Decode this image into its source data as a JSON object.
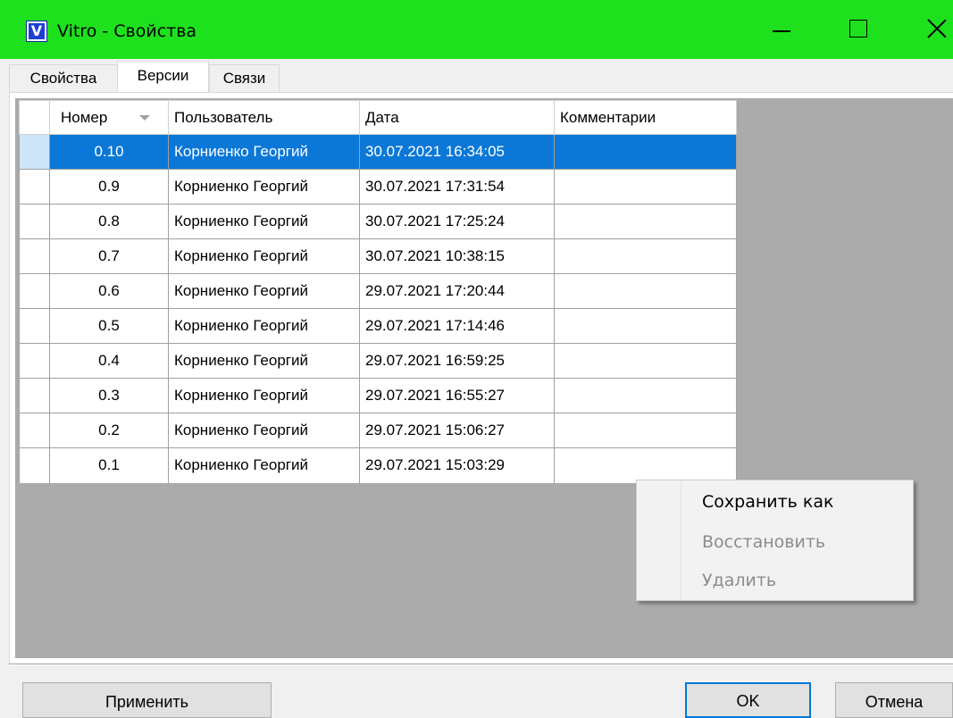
{
  "window": {
    "app_icon_letter": "V",
    "title": "Vitro - Свойства",
    "titlebar_color": "#1ee11e"
  },
  "tabs": [
    {
      "label": "Свойства",
      "active": false
    },
    {
      "label": "Версии",
      "active": true
    },
    {
      "label": "Связи",
      "active": false
    }
  ],
  "grid": {
    "columns": [
      "Номер",
      "Пользователь",
      "Дата",
      "Комментарии"
    ],
    "sort_column": "Номер",
    "selected_row": 0,
    "rows": [
      {
        "number": "0.10",
        "user": "Корниенко Георгий",
        "date": "30.07.2021 16:34:05",
        "comment": ""
      },
      {
        "number": "0.9",
        "user": "Корниенко Георгий",
        "date": "30.07.2021 17:31:54",
        "comment": ""
      },
      {
        "number": "0.8",
        "user": "Корниенко Георгий",
        "date": "30.07.2021 17:25:24",
        "comment": ""
      },
      {
        "number": "0.7",
        "user": "Корниенко Георгий",
        "date": "30.07.2021 10:38:15",
        "comment": ""
      },
      {
        "number": "0.6",
        "user": "Корниенко Георгий",
        "date": "29.07.2021 17:20:44",
        "comment": ""
      },
      {
        "number": "0.5",
        "user": "Корниенко Георгий",
        "date": "29.07.2021 17:14:46",
        "comment": ""
      },
      {
        "number": "0.4",
        "user": "Корниенко Георгий",
        "date": "29.07.2021 16:59:25",
        "comment": ""
      },
      {
        "number": "0.3",
        "user": "Корниенко Георгий",
        "date": "29.07.2021 16:55:27",
        "comment": ""
      },
      {
        "number": "0.2",
        "user": "Корниенко Георгий",
        "date": "29.07.2021 15:06:27",
        "comment": ""
      },
      {
        "number": "0.1",
        "user": "Корниенко Георгий",
        "date": "29.07.2021 15:03:29",
        "comment": ""
      }
    ]
  },
  "context_menu": {
    "items": [
      {
        "label": "Сохранить как",
        "enabled": true
      },
      {
        "label": "Восстановить",
        "enabled": false
      },
      {
        "label": "Удалить",
        "enabled": false
      }
    ]
  },
  "buttons": {
    "apply": "Применить",
    "ok": "OK",
    "cancel": "Отмена"
  },
  "colors": {
    "selection": "#0b78d7",
    "grid_background": "#ababab"
  }
}
